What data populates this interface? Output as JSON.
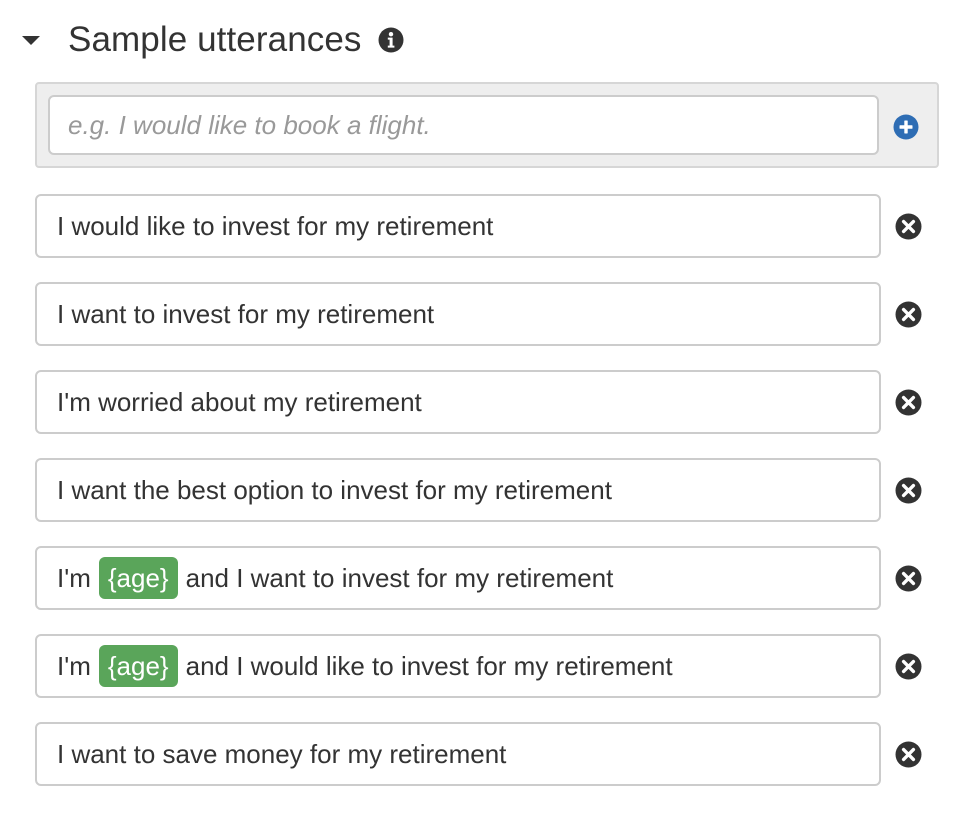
{
  "section": {
    "title": "Sample utterances",
    "caret_icon": "caret-down-icon",
    "info_icon": "info-icon"
  },
  "new_utterance": {
    "placeholder": "e.g. I would like to book a flight.",
    "value": "",
    "add_icon": "plus-circle-icon"
  },
  "utterances": [
    {
      "text": "I would like to invest for my retirement"
    },
    {
      "text": "I want to invest for my retirement"
    },
    {
      "text": "I'm worried about my retirement"
    },
    {
      "text": "I want the best option to invest for my retirement"
    },
    {
      "before": "I'm",
      "slot": "{age}",
      "after": "and I want to invest for my retirement"
    },
    {
      "before": "I'm",
      "slot": "{age}",
      "after": "and I would like to invest for my retirement"
    },
    {
      "text": "I want to save money for my retirement"
    }
  ],
  "colors": {
    "slot_bg": "#5aa55a",
    "add_icon": "#2e6db4",
    "remove_icon": "#333333",
    "panel_bg": "#eeeeee"
  }
}
